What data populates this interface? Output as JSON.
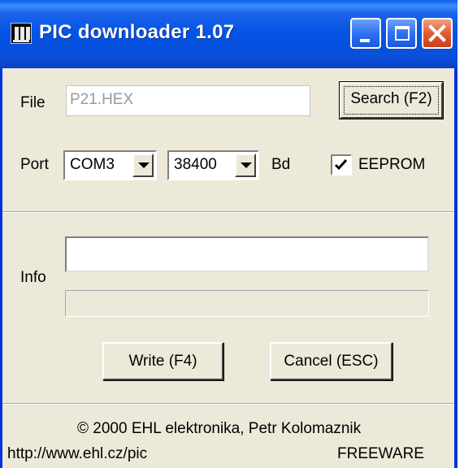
{
  "window": {
    "title": "PIC downloader 1.07",
    "app_icon": "chip-icon"
  },
  "titlebar_buttons": {
    "minimize_icon": "minimize-icon",
    "maximize_icon": "maximize-icon",
    "close_icon": "close-icon"
  },
  "file": {
    "label": "File",
    "value": "P21.HEX",
    "search_button": "Search (F2)"
  },
  "port": {
    "label": "Port",
    "port_selected": "COM3",
    "baud_selected": "38400",
    "baud_unit": "Bd",
    "eeprom_label": "EEPROM",
    "eeprom_checked": true
  },
  "info": {
    "label": "Info",
    "value": "",
    "progress": 0
  },
  "actions": {
    "write_button": "Write (F4)",
    "cancel_button": "Cancel (ESC)"
  },
  "footer": {
    "copyright": "© 2000 EHL elektronika, Petr Kolomaznik",
    "url": "http://www.ehl.cz/pic",
    "license": "FREEWARE"
  },
  "colors": {
    "titlebar": "#0453e4",
    "window_bg": "#ece9d8",
    "close_button": "#e25b35",
    "disabled_text": "#9a9a9a"
  }
}
